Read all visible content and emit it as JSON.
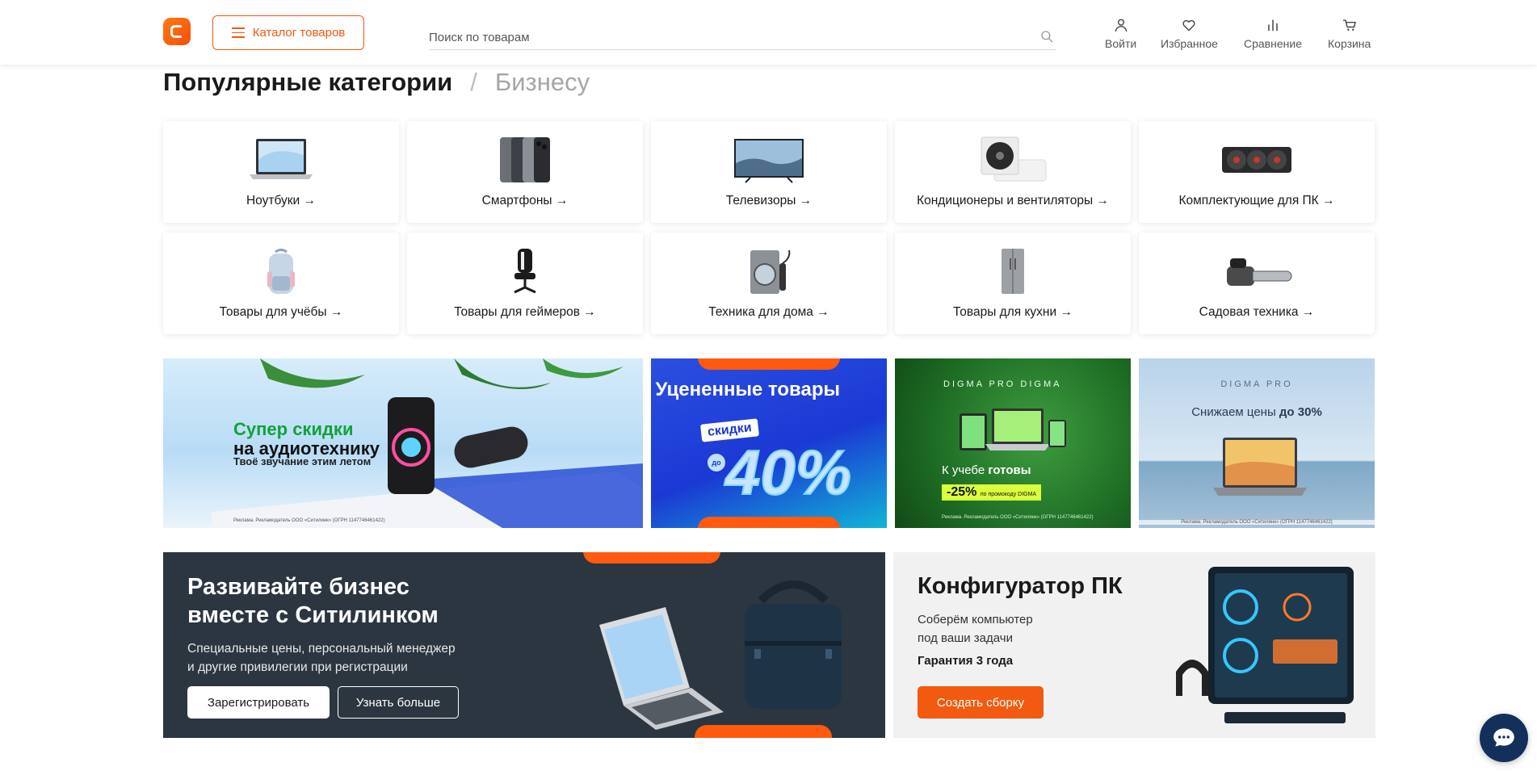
{
  "header": {
    "catalog_label": "Каталог товаров",
    "search_placeholder": "Поиск по товарам",
    "nav": {
      "login": "Войти",
      "favorites": "Избранное",
      "compare": "Сравнение",
      "cart": "Корзина"
    },
    "colors": {
      "brand": "#f15a0f"
    }
  },
  "page": {
    "title": "Популярные категории",
    "separator": "/",
    "alt_title": "Бизнесу"
  },
  "categories": [
    {
      "label": "Ноутбуки →",
      "icon": "laptop-icon"
    },
    {
      "label": "Смартфоны →",
      "icon": "smartphone-icon"
    },
    {
      "label": "Телевизоры →",
      "icon": "tv-icon"
    },
    {
      "label": "Кондиционеры и вентиляторы →",
      "icon": "air-conditioner-icon"
    },
    {
      "label": "Комплектующие для ПК →",
      "icon": "gpu-icon"
    },
    {
      "label": "Товары для учёбы →",
      "icon": "backpack-icon"
    },
    {
      "label": "Товары для геймеров →",
      "icon": "gaming-chair-icon"
    },
    {
      "label": "Техника для дома →",
      "icon": "washing-machine-icon"
    },
    {
      "label": "Товары для кухни →",
      "icon": "fridge-icon"
    },
    {
      "label": "Садовая техника →",
      "icon": "chainsaw-icon"
    }
  ],
  "banners": {
    "audio": {
      "title_green": "Супер скидки",
      "title_rest": "на аудиотехнику",
      "subtitle": "Твоё звучание этим летом",
      "fine": "Реклама. Рекламодатель ООО «Ситилинк» (ОГРН 1147746461422)"
    },
    "used": {
      "title": "Уцененные товары",
      "tag": "скидки",
      "prefix": "до",
      "value": "40%"
    },
    "digma_study": {
      "brand": "DIGMA PRO   DIGMA",
      "title_normal": "К учебе ",
      "title_bold": "готовы",
      "promo": "-25%",
      "promo_note": "по промокоду DIGMA",
      "fine": "Реклама. Рекламодатель ООО «Ситилинк» (ОГРН 1147746461422)"
    },
    "digma_pro": {
      "brand": "DIGMA PRO",
      "title_normal": "Снижаем цены ",
      "title_bold": "до 30%",
      "fine": "Реклама. Рекламодатель ООО «Ситилинк» (ОГРН 1147746461422)"
    }
  },
  "promo_business": {
    "title_line1": "Развивайте бизнес",
    "title_line2": "вместе с Ситилинком",
    "desc_line1": "Специальные цены, персональный менеджер",
    "desc_line2": "и другие привилегии при регистрации",
    "register_label": "Зарегистрировать",
    "more_label": "Узнать больше"
  },
  "promo_pc": {
    "title": "Конфигуратор ПК",
    "desc_line1": "Соберём компьютер",
    "desc_line2": "под ваши задачи",
    "guarantee": "Гарантия 3 года",
    "button_label": "Создать сборку"
  }
}
